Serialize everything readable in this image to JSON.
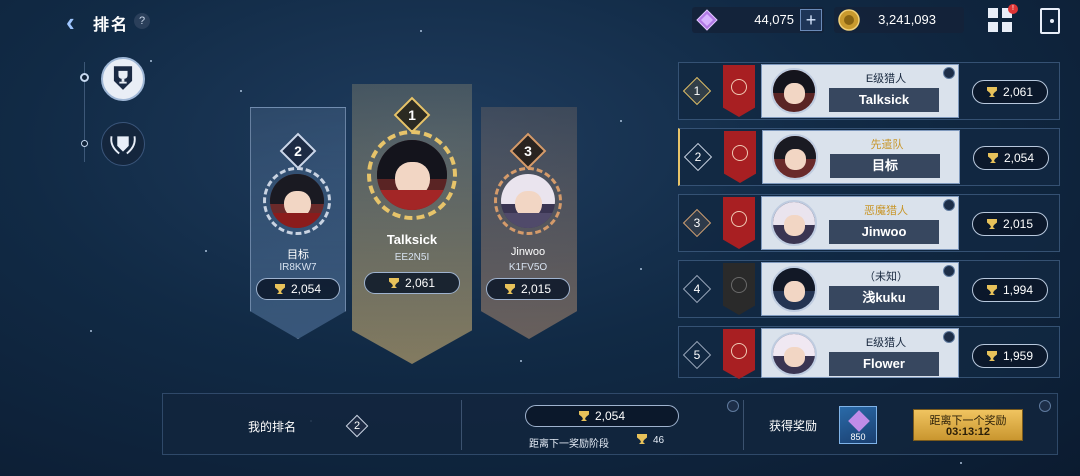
{
  "header": {
    "title": "排名",
    "help": "?",
    "back_icon": "arrow-left-icon"
  },
  "currency": {
    "gems": "44,075",
    "gold": "3,241,093",
    "plus": "+",
    "badge": "!"
  },
  "podium": [
    {
      "rank": "2",
      "name": "目标",
      "id": "IR8KW7",
      "score": "2,054"
    },
    {
      "rank": "1",
      "name": "Talksick",
      "id": "EE2N5I",
      "score": "2,061"
    },
    {
      "rank": "3",
      "name": "Jinwoo",
      "id": "K1FV5O",
      "score": "2,015"
    }
  ],
  "leaderboard": [
    {
      "rank": "1",
      "title": "E级猎人",
      "name": "Talksick",
      "score": "2,061"
    },
    {
      "rank": "2",
      "title": "先遣队",
      "name": "目标",
      "score": "2,054"
    },
    {
      "rank": "3",
      "title": "恶魔猎人",
      "name": "Jinwoo",
      "score": "2,015"
    },
    {
      "rank": "4",
      "title": "（未知）",
      "name": "浅kuku",
      "score": "1,994"
    },
    {
      "rank": "5",
      "title": "E级猎人",
      "name": "Flower",
      "score": "1,959"
    }
  ],
  "bottom": {
    "my_rank_label": "我的排名",
    "my_rank": "2",
    "my_score": "2,054",
    "next_tier_label": "距离下一奖励阶段",
    "next_tier_value": "46",
    "reward_label": "获得奖励",
    "reward_count": "850",
    "next_reward_label": "距离下一个奖励",
    "next_reward_timer": "03:13:12"
  },
  "colors": {
    "accent_gold": "#e7c46a",
    "background": "#112a45"
  }
}
